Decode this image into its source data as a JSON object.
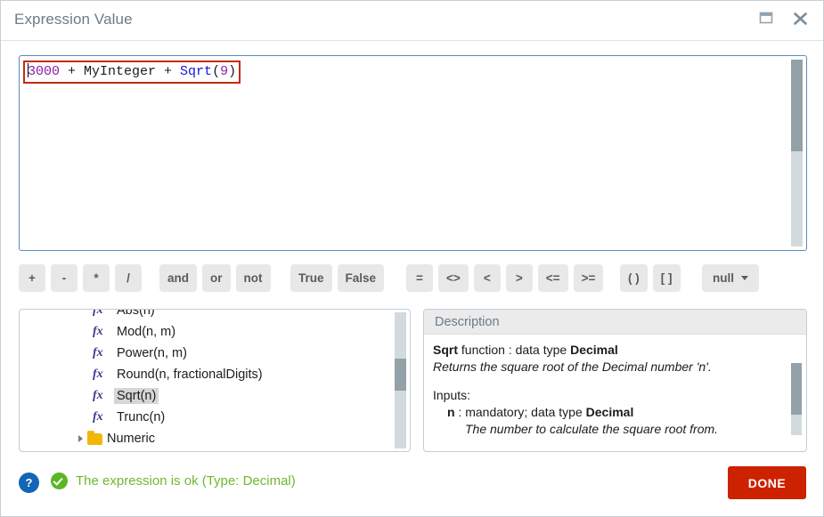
{
  "window": {
    "title": "Expression Value",
    "controls": [
      {
        "name": "maximize-button",
        "icon": "maximize-icon"
      },
      {
        "name": "close-button",
        "icon": "close-icon"
      }
    ]
  },
  "editor": {
    "expression": "3000 + MyInteger + Sqrt(9)",
    "tokens": [
      {
        "text": "3000",
        "kind": "number"
      },
      {
        "text": " + MyInteger + ",
        "kind": "plain"
      },
      {
        "text": "Sqrt",
        "kind": "function"
      },
      {
        "text": "(",
        "kind": "plain"
      },
      {
        "text": "9",
        "kind": "number"
      },
      {
        "text": ")",
        "kind": "plain"
      }
    ],
    "caret_visible": true,
    "colors": {
      "number": "#8f1fa8",
      "plain": "#1c1c1c",
      "function": "#1515d6",
      "error_box": "#c42b11",
      "panel_border": "#5a8cbf"
    }
  },
  "toolbar": {
    "groups": [
      {
        "name": "arithmetic",
        "buttons": [
          "+",
          "-",
          "*",
          "/"
        ]
      },
      {
        "name": "logical",
        "buttons": [
          "and",
          "or",
          "not"
        ]
      },
      {
        "name": "boolean",
        "buttons": [
          "True",
          "False"
        ]
      },
      {
        "name": "comparison",
        "buttons": [
          "=",
          "<>",
          "<",
          ">",
          "<=",
          ">="
        ]
      },
      {
        "name": "brackets",
        "buttons": [
          "( )",
          "[ ]"
        ]
      }
    ],
    "null_dropdown": {
      "label": "null",
      "icon": "chevron-down-icon"
    }
  },
  "function_list": {
    "items": [
      {
        "label": "Abs(n)",
        "icon": "fx-icon",
        "selected": false,
        "clipped": true
      },
      {
        "label": "Mod(n, m)",
        "icon": "fx-icon",
        "selected": false
      },
      {
        "label": "Power(n, m)",
        "icon": "fx-icon",
        "selected": false
      },
      {
        "label": "Round(n, fractionalDigits)",
        "icon": "fx-icon",
        "selected": false
      },
      {
        "label": "Sqrt(n)",
        "icon": "fx-icon",
        "selected": true
      },
      {
        "label": "Trunc(n)",
        "icon": "fx-icon",
        "selected": false
      }
    ],
    "fx_glyph": "fx",
    "folder": {
      "label": "Numeric",
      "icon": "folder-icon",
      "caret": "expand-caret-icon"
    }
  },
  "description": {
    "header": "Description",
    "lines": [
      {
        "segments": [
          {
            "text": "Sqrt",
            "style": "bold"
          },
          {
            "text": " function : data type ",
            "style": "normal"
          },
          {
            "text": "Decimal",
            "style": "bold"
          }
        ],
        "indent": 0
      },
      {
        "segments": [
          {
            "text": "Returns the square root of the Decimal number 'n'.",
            "style": "italic"
          }
        ],
        "indent": 0
      },
      {
        "segments": [],
        "indent": 0,
        "spacer": true
      },
      {
        "segments": [
          {
            "text": "Inputs:",
            "style": "normal"
          }
        ],
        "indent": 0
      },
      {
        "segments": [
          {
            "text": "n",
            "style": "bold"
          },
          {
            "text": " : mandatory; data type ",
            "style": "normal"
          },
          {
            "text": "Decimal",
            "style": "bold"
          }
        ],
        "indent": 1
      },
      {
        "segments": [
          {
            "text": "The number to calculate the square root from.",
            "style": "italic"
          }
        ],
        "indent": 2
      }
    ]
  },
  "footer": {
    "help_label": "?",
    "status_text": "The expression is ok (Type: Decimal)",
    "status_icon": "check-circle-icon",
    "status_color": "#6fb82e",
    "done_label": "DONE",
    "done_color": "#cc2200"
  }
}
